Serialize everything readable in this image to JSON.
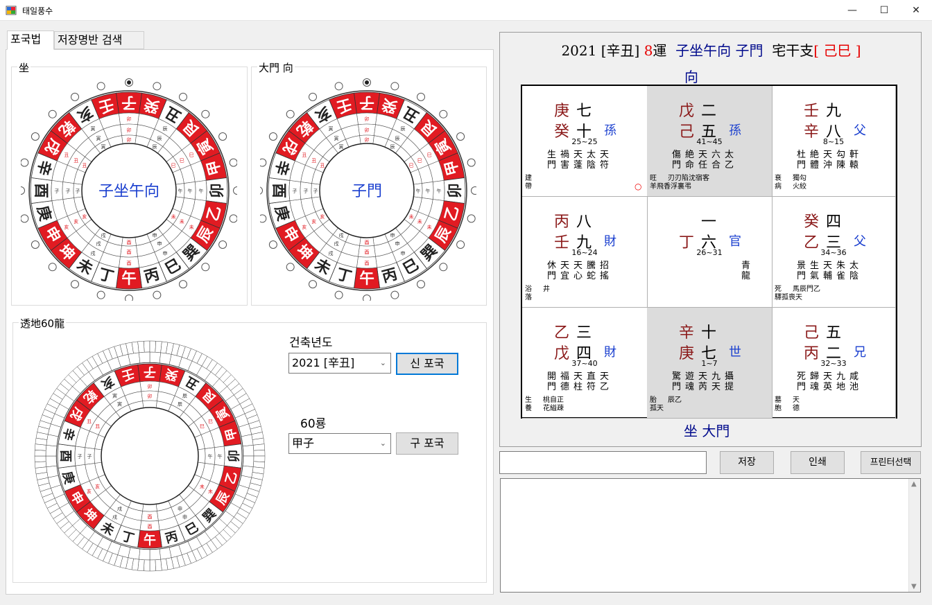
{
  "window": {
    "title": "태일풍수",
    "min": "—",
    "max": "☐",
    "close": "✕"
  },
  "tabs": [
    {
      "label": "포국법"
    },
    {
      "label": "저장명반 검색"
    }
  ],
  "sit_group": {
    "label": "坐",
    "center": "子坐午向"
  },
  "gate_group": {
    "label": "大門 向",
    "center": "子門"
  },
  "dragon_group": {
    "label": "透地60龍"
  },
  "year": {
    "label": "건축년도",
    "value": "2021 [辛丑]",
    "new_btn": "신 포국"
  },
  "dragon60": {
    "label": "60룡",
    "value": "甲子",
    "old_btn": "구 포국"
  },
  "compass": {
    "ring_outer": [
      "子",
      "癸",
      "丑",
      "艮",
      "寅",
      "甲",
      "卯",
      "乙",
      "辰",
      "巽",
      "巳",
      "丙",
      "午",
      "丁",
      "未",
      "坤",
      "申",
      "庚",
      "酉",
      "辛",
      "戌",
      "乾",
      "亥",
      "壬"
    ],
    "red_marked": [
      "子",
      "癸",
      "艮",
      "寅",
      "甲",
      "乙",
      "辰",
      "午",
      "坤",
      "申",
      "戌",
      "乾",
      "壬"
    ],
    "selected_index": 0
  },
  "chart": {
    "header": {
      "year": "2021",
      "year_stem": "[辛丑]",
      "run_num": "8",
      "run": "運",
      "direction": "子坐午向",
      "gate": "子門",
      "house_label": "宅干支",
      "house_value": "[ 己巳 ]"
    },
    "top_label": "向",
    "bottom_label": "坐  大門",
    "cells": [
      {
        "s1": "庚",
        "n1": "七",
        "s2": "癸",
        "n2": "十",
        "k": "孫",
        "rng": "25~25",
        "r1": "生禍天太天",
        "r2": "門害蓬陰符",
        "f1": "建",
        "f2": "帶",
        "mark": "○",
        "shade": false
      },
      {
        "s1": "戊",
        "n1": "二",
        "s2": "己",
        "n2": "五",
        "k": "孫",
        "rng": "41~45",
        "r1": "傷絶天六太",
        "r2": "門命任合乙",
        "f1": "旺",
        "f2": "羊飛香浮裏弔",
        "f3": "刃刃陷沈宿客",
        "shade": true
      },
      {
        "s1": "壬",
        "n1": "九",
        "s2": "辛",
        "n2": "八",
        "k": "父",
        "rng": "8~15",
        "r1": "杜絶天勾軒",
        "r2": "門體沖陳轅",
        "f1": "衰",
        "f2": "病",
        "f3": "獨勾",
        "f4": "火絞",
        "shade": false
      },
      {
        "s1": "丙",
        "n1": "八",
        "s2": "壬",
        "n2": "九",
        "k": "財",
        "rng": "16~24",
        "r1": "休天天騰招",
        "r2": "門宜心蛇搖",
        "f1": "浴",
        "f2": "落",
        "f3": "井",
        "shade": false
      },
      {
        "s1": "",
        "n1": "一",
        "s2": "丁",
        "n2": "六",
        "k": "官",
        "rng": "26~31",
        "r1": "青",
        "r2": "龍",
        "shade": false
      },
      {
        "s1": "癸",
        "n1": "四",
        "s2": "乙",
        "n2": "三",
        "k": "父",
        "rng": "34~36",
        "r1": "景生天朱太",
        "r2": "門氣輔雀陰",
        "f1": "死",
        "f2": "驛孤喪天",
        "f3": "馬辰門乙",
        "shade": false
      },
      {
        "s1": "乙",
        "n1": "三",
        "s2": "戊",
        "n2": "四",
        "k": "財",
        "rng": "37~40",
        "r1": "開福天直天",
        "r2": "門德柱符乙",
        "f1": "生",
        "f2": "養",
        "f3": "桃自正",
        "f4": "花縊疎",
        "shade": false
      },
      {
        "s1": "辛",
        "n1": "十",
        "s2": "庚",
        "n2": "七",
        "k": "世",
        "rng": "1~7",
        "r1": "驚遊天九攝",
        "r2": "門魂芮天提",
        "f1": "胎",
        "f2": "孤天",
        "f3": "辰乙",
        "shade": true
      },
      {
        "s1": "己",
        "n1": "五",
        "s2": "丙",
        "n2": "二",
        "k": "兄",
        "rng": "32~33",
        "r1": "死歸天九咸",
        "r2": "門魂英地池",
        "f1": "墓",
        "f2": "胞",
        "f3": "天",
        "f4": "德",
        "shade": false
      }
    ]
  },
  "actions": {
    "save": "저장",
    "print": "인쇄",
    "printer": "프린터선택",
    "name_placeholder": ""
  },
  "colors": {
    "red": "#e11b22",
    "navy": "#000a8c",
    "stem": "#8b1a1a",
    "blue": "#1a3fcf",
    "shade": "#dcdcdc"
  }
}
